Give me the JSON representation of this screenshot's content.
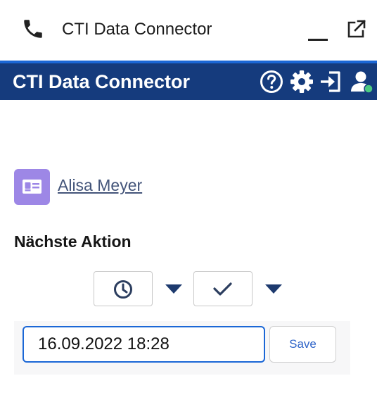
{
  "window": {
    "title": "CTI Data Connector"
  },
  "header": {
    "title": "CTI Data Connector"
  },
  "icons": {
    "phone": "phone-icon",
    "minimize": "minimize-icon",
    "popout": "external-link-icon",
    "help": "help-icon",
    "settings": "gear-icon",
    "login": "sign-in-icon",
    "user": "user-status-icon",
    "contact": "contact-card-icon",
    "clock": "clock-icon",
    "check": "check-icon",
    "dropdown": "chevron-down-icon"
  },
  "colors": {
    "header_bg": "#153b7d",
    "header_accent": "#1b67d6",
    "avatar_bg": "#9d87e6",
    "status_online": "#4bca81",
    "link": "#44557a",
    "save_text": "#2d63c8"
  },
  "contact": {
    "name": "Alisa Meyer"
  },
  "next_action": {
    "title": "Nächste Aktion",
    "datetime_value": "16.09.2022 18:28",
    "save_label": "Save"
  }
}
